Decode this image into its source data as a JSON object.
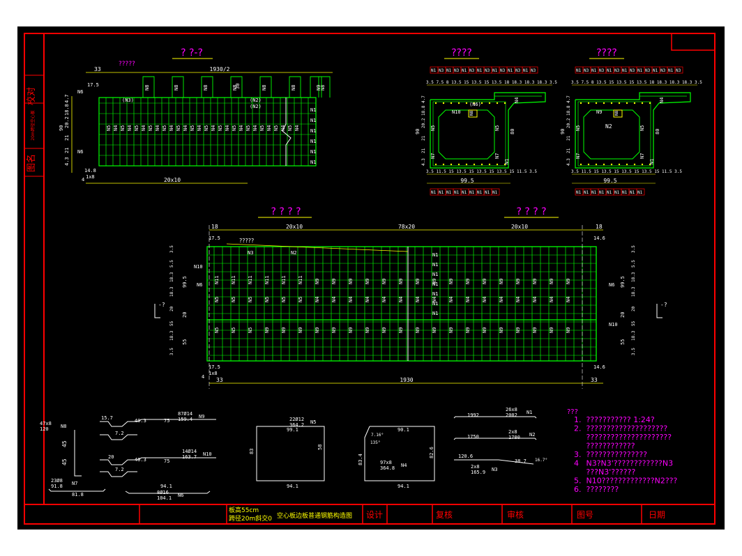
{
  "sheet": {
    "side_labels": [
      "图名",
      "20m跨径空心板",
      "校对"
    ],
    "title_block": {
      "left_line1": "板高55cm",
      "left_line2": "跨径20m斜交0",
      "drawing_title": "空心板边板普通钢筋构造图",
      "design": "设计",
      "check": "复核",
      "review": "审核",
      "drawing_no": "图号",
      "date": "日期"
    }
  },
  "views": {
    "elevation_title": "? ?-?",
    "elevation_note": "?????",
    "elevation_dim_top": "1930/2",
    "elevation_dim_33": "33",
    "elevation_bottom_dim": "20x10",
    "elevation_dim_175": "17.5",
    "elevation_n3": "(N3)",
    "elevation_n2a": "(N2)",
    "elevation_n2b": "(N2)",
    "section1_title": "????",
    "section2_title": "????",
    "section1_dim_bottom": "99.5",
    "section2_dim_bottom": "99.5",
    "section1_n10": "N10",
    "section1_n6": "(N6)",
    "section2_n9": "N9",
    "section2_n2": "N2",
    "plan_title_left": "? ? ? ?",
    "plan_title_right": "? ? ? ?",
    "plan_note": "?????",
    "plan_dim_top_left": "20x10",
    "plan_dim_top_mid": "78x20",
    "plan_dim_top_right": "20x10",
    "plan_dim_bottom": "1930",
    "plan_dim_18_left": "18",
    "plan_dim_18_right": "18",
    "plan_dim_33_left": "33",
    "plan_dim_33_right": "33",
    "plan_n3": "N3",
    "plan_n2": "N2"
  },
  "bars": [
    {
      "label": "N8",
      "line1": "47x8",
      "line2": "120"
    },
    {
      "label": "N9",
      "line1": "87Ø14",
      "line2": "159.4"
    },
    {
      "label": "N10",
      "line1": "14Ø14",
      "line2": "163.7"
    },
    {
      "label": "N7",
      "line1": "23Ø8",
      "line2": "91.8"
    },
    {
      "label": "N6",
      "line1": "8Ø16",
      "line2": "104.1"
    },
    {
      "label": "N5",
      "line1": "22Ø12",
      "line2": "364.2"
    },
    {
      "label": "N4",
      "line1": "97x8",
      "line2": "364.8"
    },
    {
      "label": "N1",
      "line1": "26x8",
      "line2": "2002"
    },
    {
      "label": "N2",
      "line1": "2x8",
      "line2": "1780"
    },
    {
      "label": "N3",
      "line1": "2x8",
      "line2": "165.9"
    }
  ],
  "bar_dims": {
    "n8_len": "45",
    "n9_a": "15.7",
    "n9_b": "7.2",
    "n9_c": "40.3",
    "n9_d": "75",
    "n10_a": "20",
    "n10_b": "7.2",
    "n10_c": "40.3",
    "n10_d": "75",
    "n7_len": "81.8",
    "n6_len": "94.1",
    "n5_w": "99.1",
    "n5_h": "83",
    "n5_b": "94.1",
    "n5_r": "58",
    "n4_w": "90.1",
    "n4_b": "94.1",
    "n4_h": "83.4",
    "n4_r": "82.6",
    "n4_ang1": "135°",
    "n4_ang2": "7.16°",
    "n1_len": "1992",
    "n2_len": "1750",
    "n3_len": "120.6",
    "n3_ang": "16.7°",
    "n3_side": "38.7"
  },
  "notes": {
    "heading": "???",
    "items": [
      "1.  ??????????? 1:24?",
      "2.  ????????????????????",
      "     ?????????????????????",
      "     ????????????",
      "3.  ???????????????",
      "4   N3?N3'????????????N3",
      "     ???N3'??????",
      "5.  N10?????????????N2???",
      "6.  ????????"
    ]
  },
  "colors": {
    "frame": "#ff0000",
    "drawing": "#00ff00",
    "dim": "#ffff00",
    "note": "#ff00ff",
    "label": "#ffffff"
  }
}
